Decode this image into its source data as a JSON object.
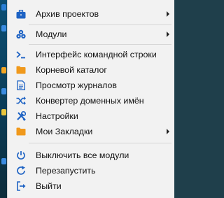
{
  "menu": {
    "items": [
      {
        "label": "Архив проектов",
        "icon": "briefcase-icon",
        "submenu": true
      },
      {
        "label": "Модули",
        "icon": "modules-icon",
        "submenu": true
      },
      {
        "label": "Интерфейс командной строки",
        "icon": "terminal-icon",
        "submenu": false
      },
      {
        "label": "Корневой каталог",
        "icon": "folder-icon",
        "submenu": false
      },
      {
        "label": "Просмотр журналов",
        "icon": "document-icon",
        "submenu": false
      },
      {
        "label": "Конвертер доменных имён",
        "icon": "shuffle-icon",
        "submenu": false
      },
      {
        "label": "Настройки",
        "icon": "wrench-screwdriver-icon",
        "submenu": false
      },
      {
        "label": "Мои Закладки",
        "icon": "folder-icon",
        "submenu": true
      },
      {
        "label": "Выключить все модули",
        "icon": "power-icon",
        "submenu": false
      },
      {
        "label": "Перезапустить",
        "icon": "restart-icon",
        "submenu": false
      },
      {
        "label": "Выйти",
        "icon": "exit-icon",
        "submenu": false
      }
    ]
  },
  "colors": {
    "menu_background": "#f2f2f2",
    "icon_blue": "#1e63c4",
    "icon_orange": "#f0991c",
    "text": "#111111",
    "separator": "#d6d6d6"
  }
}
